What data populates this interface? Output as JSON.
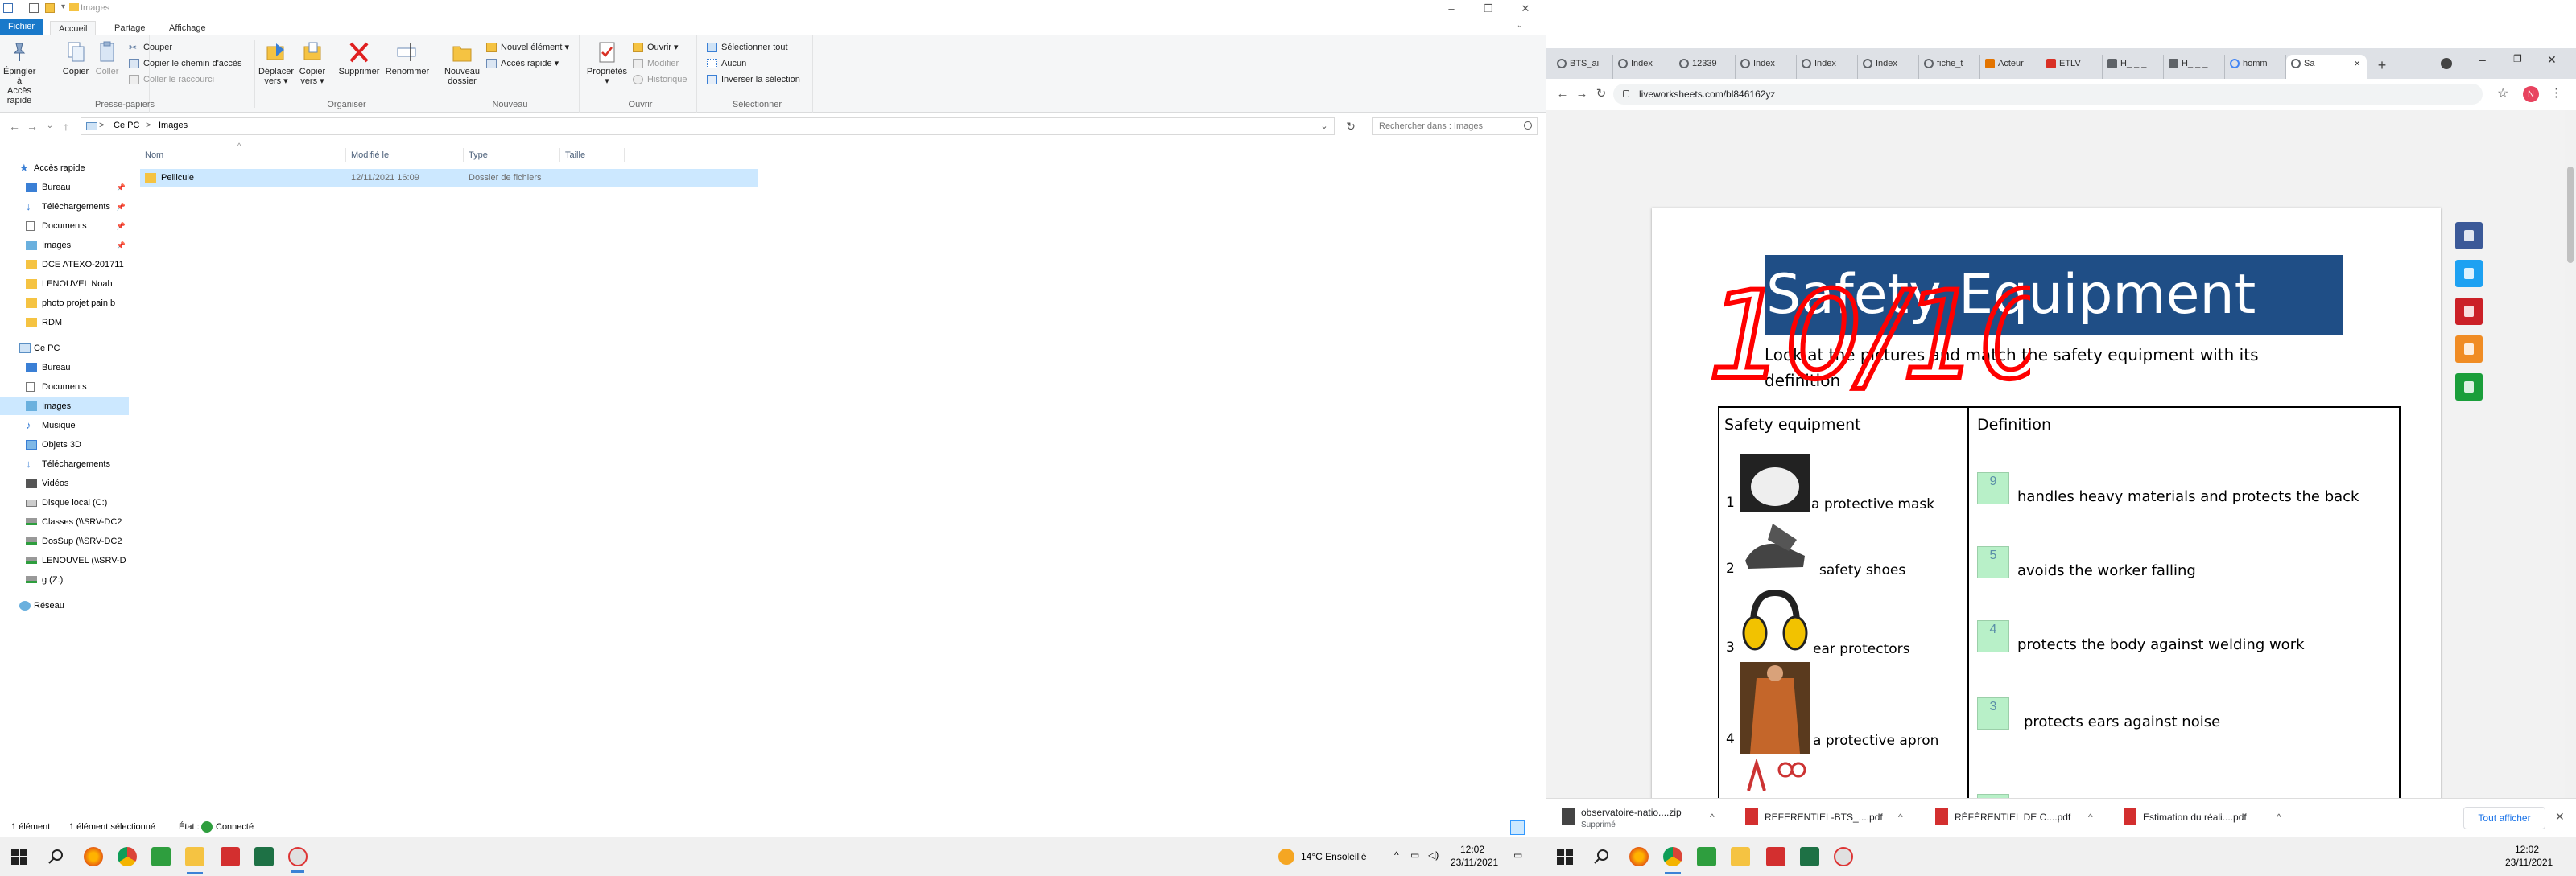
{
  "explorer": {
    "title": "Images",
    "tabs": [
      "Fichier",
      "Accueil",
      "Partage",
      "Affichage"
    ],
    "ribbon": {
      "presse_papiers": {
        "label": "Presse-papiers",
        "pin_line1": "Épingler à",
        "pin_line2": "Accès rapide",
        "copy": "Copier",
        "paste": "Coller",
        "cut": "Couper",
        "copy_path": "Copier le chemin d'accès",
        "paste_shortcut": "Coller le raccourci"
      },
      "organiser": {
        "label": "Organiser",
        "move_line1": "Déplacer",
        "move_line2": "vers ▾",
        "copyto_line1": "Copier",
        "copyto_line2": "vers ▾",
        "delete": "Supprimer",
        "rename": "Renommer"
      },
      "nouveau": {
        "label": "Nouveau",
        "new_folder_line1": "Nouveau",
        "new_folder_line2": "dossier",
        "new_item": "Nouvel élément ▾",
        "easy_access": "Accès rapide ▾"
      },
      "ouvrir": {
        "label": "Ouvrir",
        "properties_line1": "Propriétés",
        "properties_line2": "▾",
        "open": "Ouvrir ▾",
        "modify": "Modifier",
        "history": "Historique"
      },
      "selectionner": {
        "label": "Sélectionner",
        "select_all": "Sélectionner tout",
        "select_none": "Aucun",
        "invert": "Inverser la sélection"
      }
    },
    "address": {
      "crumbs": [
        "Ce PC",
        "Images"
      ],
      "separator": ">",
      "search_placeholder": "Rechercher dans : Images"
    },
    "nav": {
      "quick_access": "Accès rapide",
      "quick_items": [
        "Bureau",
        "Téléchargements",
        "Documents",
        "Images",
        "DCE ATEXO-201711",
        "LENOUVEL Noah",
        "photo projet pain b",
        "RDM"
      ],
      "this_pc": "Ce PC",
      "pc_items": [
        "Bureau",
        "Documents",
        "Images",
        "Musique",
        "Objets 3D",
        "Téléchargements",
        "Vidéos",
        "Disque local (C:)",
        "Classes (\\\\SRV-DC2",
        "DosSup (\\\\SRV-DC2",
        "LENOUVEL (\\\\SRV-D",
        "g (Z:)"
      ],
      "network": "Réseau",
      "pin_glyph": "📌"
    },
    "columns": [
      "Nom",
      "Modifié le",
      "Type",
      "Taille"
    ],
    "files": [
      {
        "name": "Pellicule",
        "modified": "12/11/2021 16:09",
        "type": "Dossier de fichiers",
        "size": ""
      }
    ],
    "status": {
      "count": "1 élément",
      "selected": "1 élément sélectionné",
      "state_label": "État :",
      "state_value": "Connecté"
    }
  },
  "chrome": {
    "tabs": [
      {
        "label": "BTS_ai",
        "color": "#5f6368"
      },
      {
        "label": "Index",
        "color": "#5f6368"
      },
      {
        "label": "12339",
        "color": "#5f6368"
      },
      {
        "label": "Index",
        "color": "#5f6368"
      },
      {
        "label": "Index",
        "color": "#5f6368"
      },
      {
        "label": "Index",
        "color": "#5f6368"
      },
      {
        "label": "fiche_t",
        "color": "#5f6368"
      },
      {
        "label": "Acteur",
        "color": "#e37400"
      },
      {
        "label": "ETLV",
        "color": "#d93025"
      },
      {
        "label": "H_ _ _",
        "color": "#5f6368"
      },
      {
        "label": "H_ _ _",
        "color": "#5f6368"
      },
      {
        "label": "homm",
        "color": "#4285f4"
      },
      {
        "label": "Sa",
        "color": "#5f6368"
      }
    ],
    "url": "liveworksheets.com/bl846162yz",
    "avatar_letter": "N",
    "new_tab": "+",
    "close_tab": "×"
  },
  "worksheet": {
    "title": "Safety Equipment",
    "intro": "Look at the pictures and match the safety equipment with its definition",
    "score": "10/10",
    "col1_header": "Safety equipment",
    "col2_header": "Definition",
    "items": [
      {
        "num": "1",
        "label": "a protective mask"
      },
      {
        "num": "2",
        "label": "safety shoes"
      },
      {
        "num": "3",
        "label": "ear protectors"
      },
      {
        "num": "4",
        "label": "a protective apron"
      }
    ],
    "answers": [
      {
        "box": "9",
        "text": "handles heavy materials and protects the back"
      },
      {
        "box": "5",
        "text": "avoids the worker falling"
      },
      {
        "box": "4",
        "text": "protects the body against welding work"
      },
      {
        "box": "3",
        "text": "protects ears against noise"
      }
    ],
    "share_colors": [
      "#3b5998",
      "#1da1f2",
      "#cb2027",
      "#f08c24",
      "#1a9e3a"
    ]
  },
  "downloads": {
    "items": [
      {
        "name": "observatoire-natio....zip",
        "sub": "Supprimé"
      },
      {
        "name": "REFERENTIEL-BTS_....pdf",
        "sub": ""
      },
      {
        "name": "RÉFÉRENTIEL DE C....pdf",
        "sub": ""
      },
      {
        "name": "Estimation du réali....pdf",
        "sub": ""
      }
    ],
    "show_all": "Tout afficher"
  },
  "taskbar": {
    "weather": "14°C  Ensoleillé",
    "left_time": "12:02",
    "left_date": "23/11/2021",
    "right_time": "12:02",
    "right_date": "23/11/2021"
  }
}
